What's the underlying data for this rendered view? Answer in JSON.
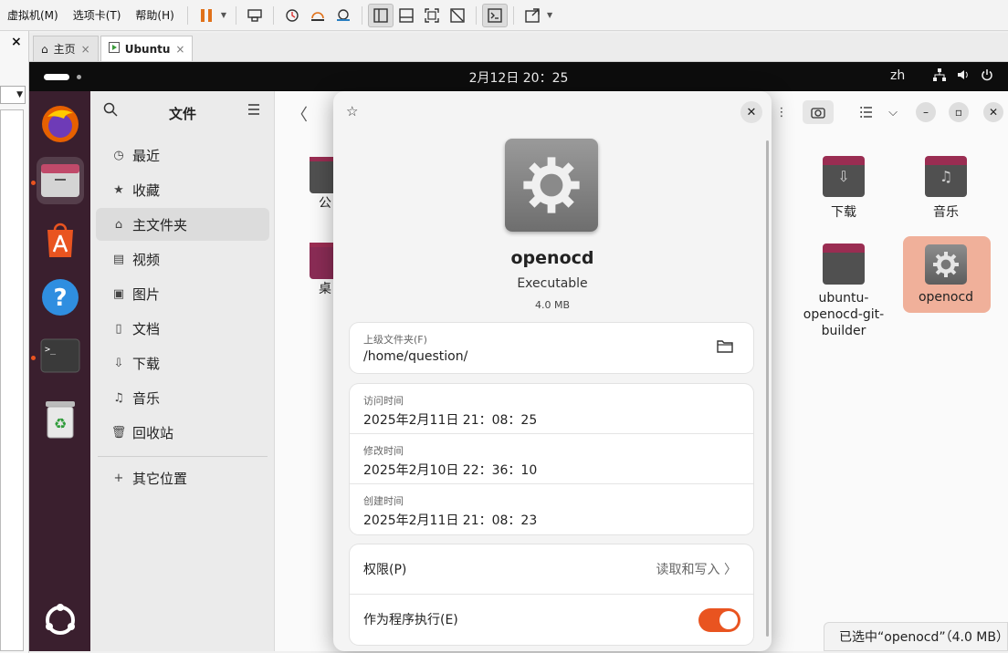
{
  "vm": {
    "menus": [
      "虚拟机(M)",
      "选项卡(T)",
      "帮助(H)"
    ],
    "tabs": [
      {
        "label": "主页"
      },
      {
        "label": "Ubuntu"
      }
    ],
    "close_glyph": "×"
  },
  "topbar": {
    "clock": "2月12日  20：25",
    "lang": "zh"
  },
  "dock": {
    "items": [
      "firefox",
      "files",
      "app-center",
      "help",
      "terminal",
      "trash",
      "show-apps"
    ]
  },
  "sidebar": {
    "title": "文件",
    "items": [
      {
        "label": "最近",
        "icon": "clock-icon"
      },
      {
        "label": "收藏",
        "icon": "star-icon"
      },
      {
        "label": "主文件夹",
        "icon": "home-icon"
      },
      {
        "label": "视频",
        "icon": "video-icon"
      },
      {
        "label": "图片",
        "icon": "picture-icon"
      },
      {
        "label": "文档",
        "icon": "document-icon"
      },
      {
        "label": "下载",
        "icon": "download-icon"
      },
      {
        "label": "音乐",
        "icon": "music-icon"
      },
      {
        "label": "回收站",
        "icon": "trash-icon"
      }
    ],
    "other": "其它位置"
  },
  "files": {
    "partial_left": [
      "公",
      "桌"
    ],
    "items": [
      {
        "label": "下载"
      },
      {
        "label": "音乐"
      },
      {
        "label": "ubuntu-\nopenocd-git-\nbuilder"
      },
      {
        "label": "openocd"
      }
    ]
  },
  "statusbar": "已选中“openocd”（4.0 MB）",
  "dialog": {
    "name": "openocd",
    "type": "Executable",
    "size": "4.0 MB",
    "parent_label": "上级文件夹(F)",
    "parent_value": "/home/question/",
    "times": [
      {
        "label": "访问时间",
        "value": "2025年2月11日 21：08：25"
      },
      {
        "label": "修改时间",
        "value": "2025年2月10日 22：36：10"
      },
      {
        "label": "创建时间",
        "value": "2025年2月11日 21：08：23"
      }
    ],
    "perm_label": "权限(P)",
    "perm_value": "读取和写入",
    "exec_label": "作为程序执行(E)",
    "exec_enabled": true
  },
  "colors": {
    "accent": "#e95420",
    "dock": "#3a1f2e",
    "selection": "#f0b09a"
  }
}
